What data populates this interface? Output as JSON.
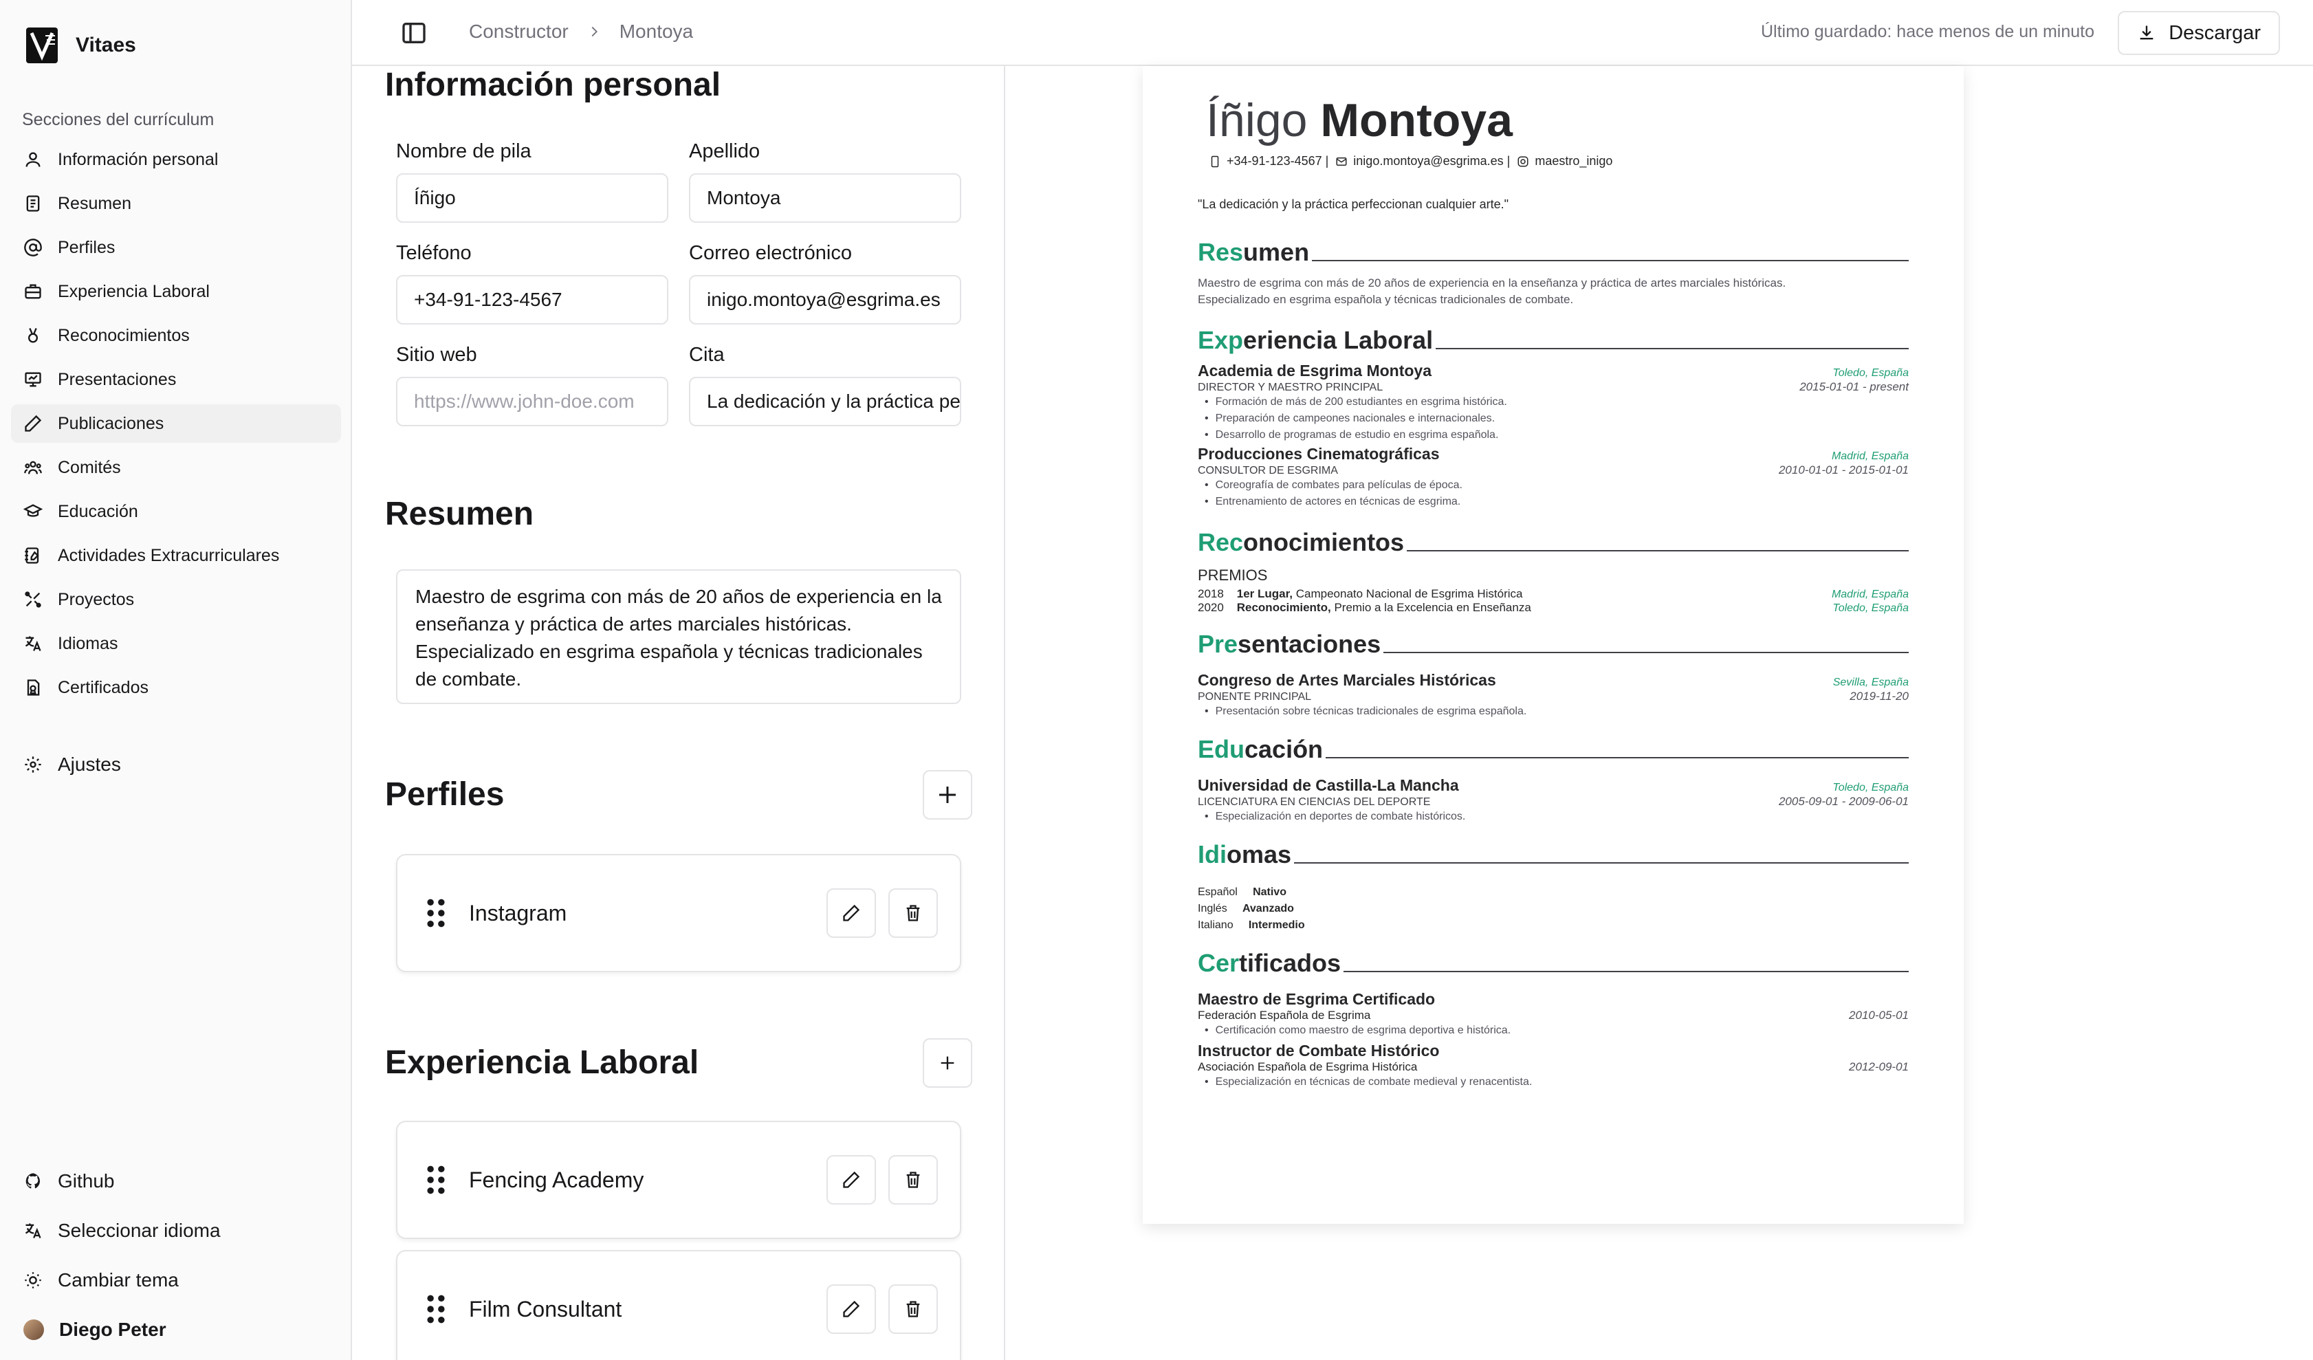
{
  "app": {
    "name": "Vitaes"
  },
  "sidebar": {
    "section_label": "Secciones del currículum",
    "items": [
      {
        "label": "Información personal",
        "icon": "user-icon"
      },
      {
        "label": "Resumen",
        "icon": "document-icon"
      },
      {
        "label": "Perfiles",
        "icon": "at-sign-icon"
      },
      {
        "label": "Experiencia Laboral",
        "icon": "briefcase-icon"
      },
      {
        "label": "Reconocimientos",
        "icon": "award-icon"
      },
      {
        "label": "Presentaciones",
        "icon": "presentation-icon"
      },
      {
        "label": "Publicaciones",
        "icon": "pen-icon"
      },
      {
        "label": "Comités",
        "icon": "users-icon"
      },
      {
        "label": "Educación",
        "icon": "graduation-cap-icon"
      },
      {
        "label": "Actividades Extracurriculares",
        "icon": "notebook-pen-icon"
      },
      {
        "label": "Proyectos",
        "icon": "tools-icon"
      },
      {
        "label": "Idiomas",
        "icon": "languages-icon"
      },
      {
        "label": "Certificados",
        "icon": "file-badge-icon"
      }
    ],
    "settings_label": "Ajustes",
    "footer": {
      "github": "Github",
      "language": "Seleccionar idioma",
      "theme": "Cambiar tema",
      "user": "Diego Peter"
    }
  },
  "topbar": {
    "crumb_root": "Constructor",
    "crumb_current": "Montoya",
    "saved": "Último guardado: hace menos de un minuto",
    "download": "Descargar"
  },
  "form": {
    "personal_title": "Información personal",
    "first_name_label": "Nombre de pila",
    "first_name": "Íñigo",
    "last_name_label": "Apellido",
    "last_name": "Montoya",
    "phone_label": "Teléfono",
    "phone": "+34-91-123-4567",
    "email_label": "Correo electrónico",
    "email": "inigo.montoya@esgrima.es",
    "website_label": "Sitio web",
    "website_placeholder": "https://www.john-doe.com",
    "quote_label": "Cita",
    "quote": "La dedicación y la práctica perfeccionan cualquier arte.",
    "summary_title": "Resumen",
    "summary": "Maestro de esgrima con más de 20 años de experiencia en la enseñanza y práctica de artes marciales históricas. Especializado en esgrima española y técnicas tradicionales de combate.",
    "profiles_title": "Perfiles",
    "profiles": [
      "Instagram"
    ],
    "experience_title": "Experiencia Laboral",
    "experience": [
      "Fencing Academy",
      "Film Consultant"
    ]
  },
  "cv": {
    "first_name": "Íñigo",
    "last_name": "Montoya",
    "phone": "+34-91-123-4567 |",
    "email": "inigo.montoya@esgrima.es |",
    "instagram": "maestro_inigo",
    "quote": "\"La dedicación y la práctica perfeccionan cualquier arte.\"",
    "accent_color": "#1f9d74",
    "summary": {
      "h_acc": "Res",
      "h_rest": "umen",
      "text1": "Maestro de esgrima con más de 20 años de experiencia en la enseñanza y práctica de artes marciales históricas.",
      "text2": "Especializado en esgrima española y técnicas tradicionales de combate."
    },
    "experience": {
      "h_acc": "Exp",
      "h_rest": "eriencia Laboral",
      "items": [
        {
          "org": "Academia de Esgrima Montoya",
          "loc": "Toledo, España",
          "role": "Director y Maestro Principal",
          "date": "2015-01-01 - present",
          "bullets": [
            "Formación de más de 200 estudiantes en esgrima histórica.",
            "Preparación de campeones nacionales e internacionales.",
            "Desarrollo de programas de estudio en esgrima española."
          ]
        },
        {
          "org": "Producciones Cinematográficas",
          "loc": "Madrid, España",
          "role": "Consultor de Esgrima",
          "date": "2010-01-01 - 2015-01-01",
          "bullets": [
            "Coreografía de combates para películas de época.",
            "Entrenamiento de actores en técnicas de esgrima."
          ]
        }
      ]
    },
    "awards": {
      "h_acc": "Rec",
      "h_rest": "onocimientos",
      "group": "PREMIOS",
      "items": [
        {
          "year": "2018",
          "title": "1er Lugar,",
          "desc": "Campeonato Nacional de Esgrima Histórica",
          "loc": "Madrid, España"
        },
        {
          "year": "2020",
          "title": "Reconocimiento,",
          "desc": "Premio a la Excelencia en Enseñanza",
          "loc": "Toledo, España"
        }
      ]
    },
    "presentations": {
      "h_acc": "Pre",
      "h_rest": "sentaciones",
      "org": "Congreso de Artes Marciales Históricas",
      "loc": "Sevilla, España",
      "role": "Ponente Principal",
      "date": "2019-11-20",
      "bullet": "Presentación sobre técnicas tradicionales de esgrima española."
    },
    "education": {
      "h_acc": "Edu",
      "h_rest": "cación",
      "org": "Universidad de Castilla-La Mancha",
      "loc": "Toledo, España",
      "role": "Licenciatura en Ciencias del Deporte",
      "date": "2005-09-01 - 2009-06-01",
      "bullet": "Especialización en deportes de combate históricos."
    },
    "languages": {
      "h_acc": "Idi",
      "h_rest": "omas",
      "items": [
        {
          "lang": "Español",
          "level": "Nativo"
        },
        {
          "lang": "Inglés",
          "level": "Avanzado"
        },
        {
          "lang": "Italiano",
          "level": "Intermedio"
        }
      ]
    },
    "certificates": {
      "h_acc": "Cer",
      "h_rest": "tificados",
      "items": [
        {
          "title": "Maestro de Esgrima Certificado",
          "issuer": "Federación Española de Esgrima",
          "date": "2010-05-01",
          "bullet": "Certificación como maestro de esgrima deportiva e histórica."
        },
        {
          "title": "Instructor de Combate Histórico",
          "issuer": "Asociación Española de Esgrima Histórica",
          "date": "2012-09-01",
          "bullet": "Especialización en técnicas de combate medieval y renacentista."
        }
      ]
    }
  }
}
